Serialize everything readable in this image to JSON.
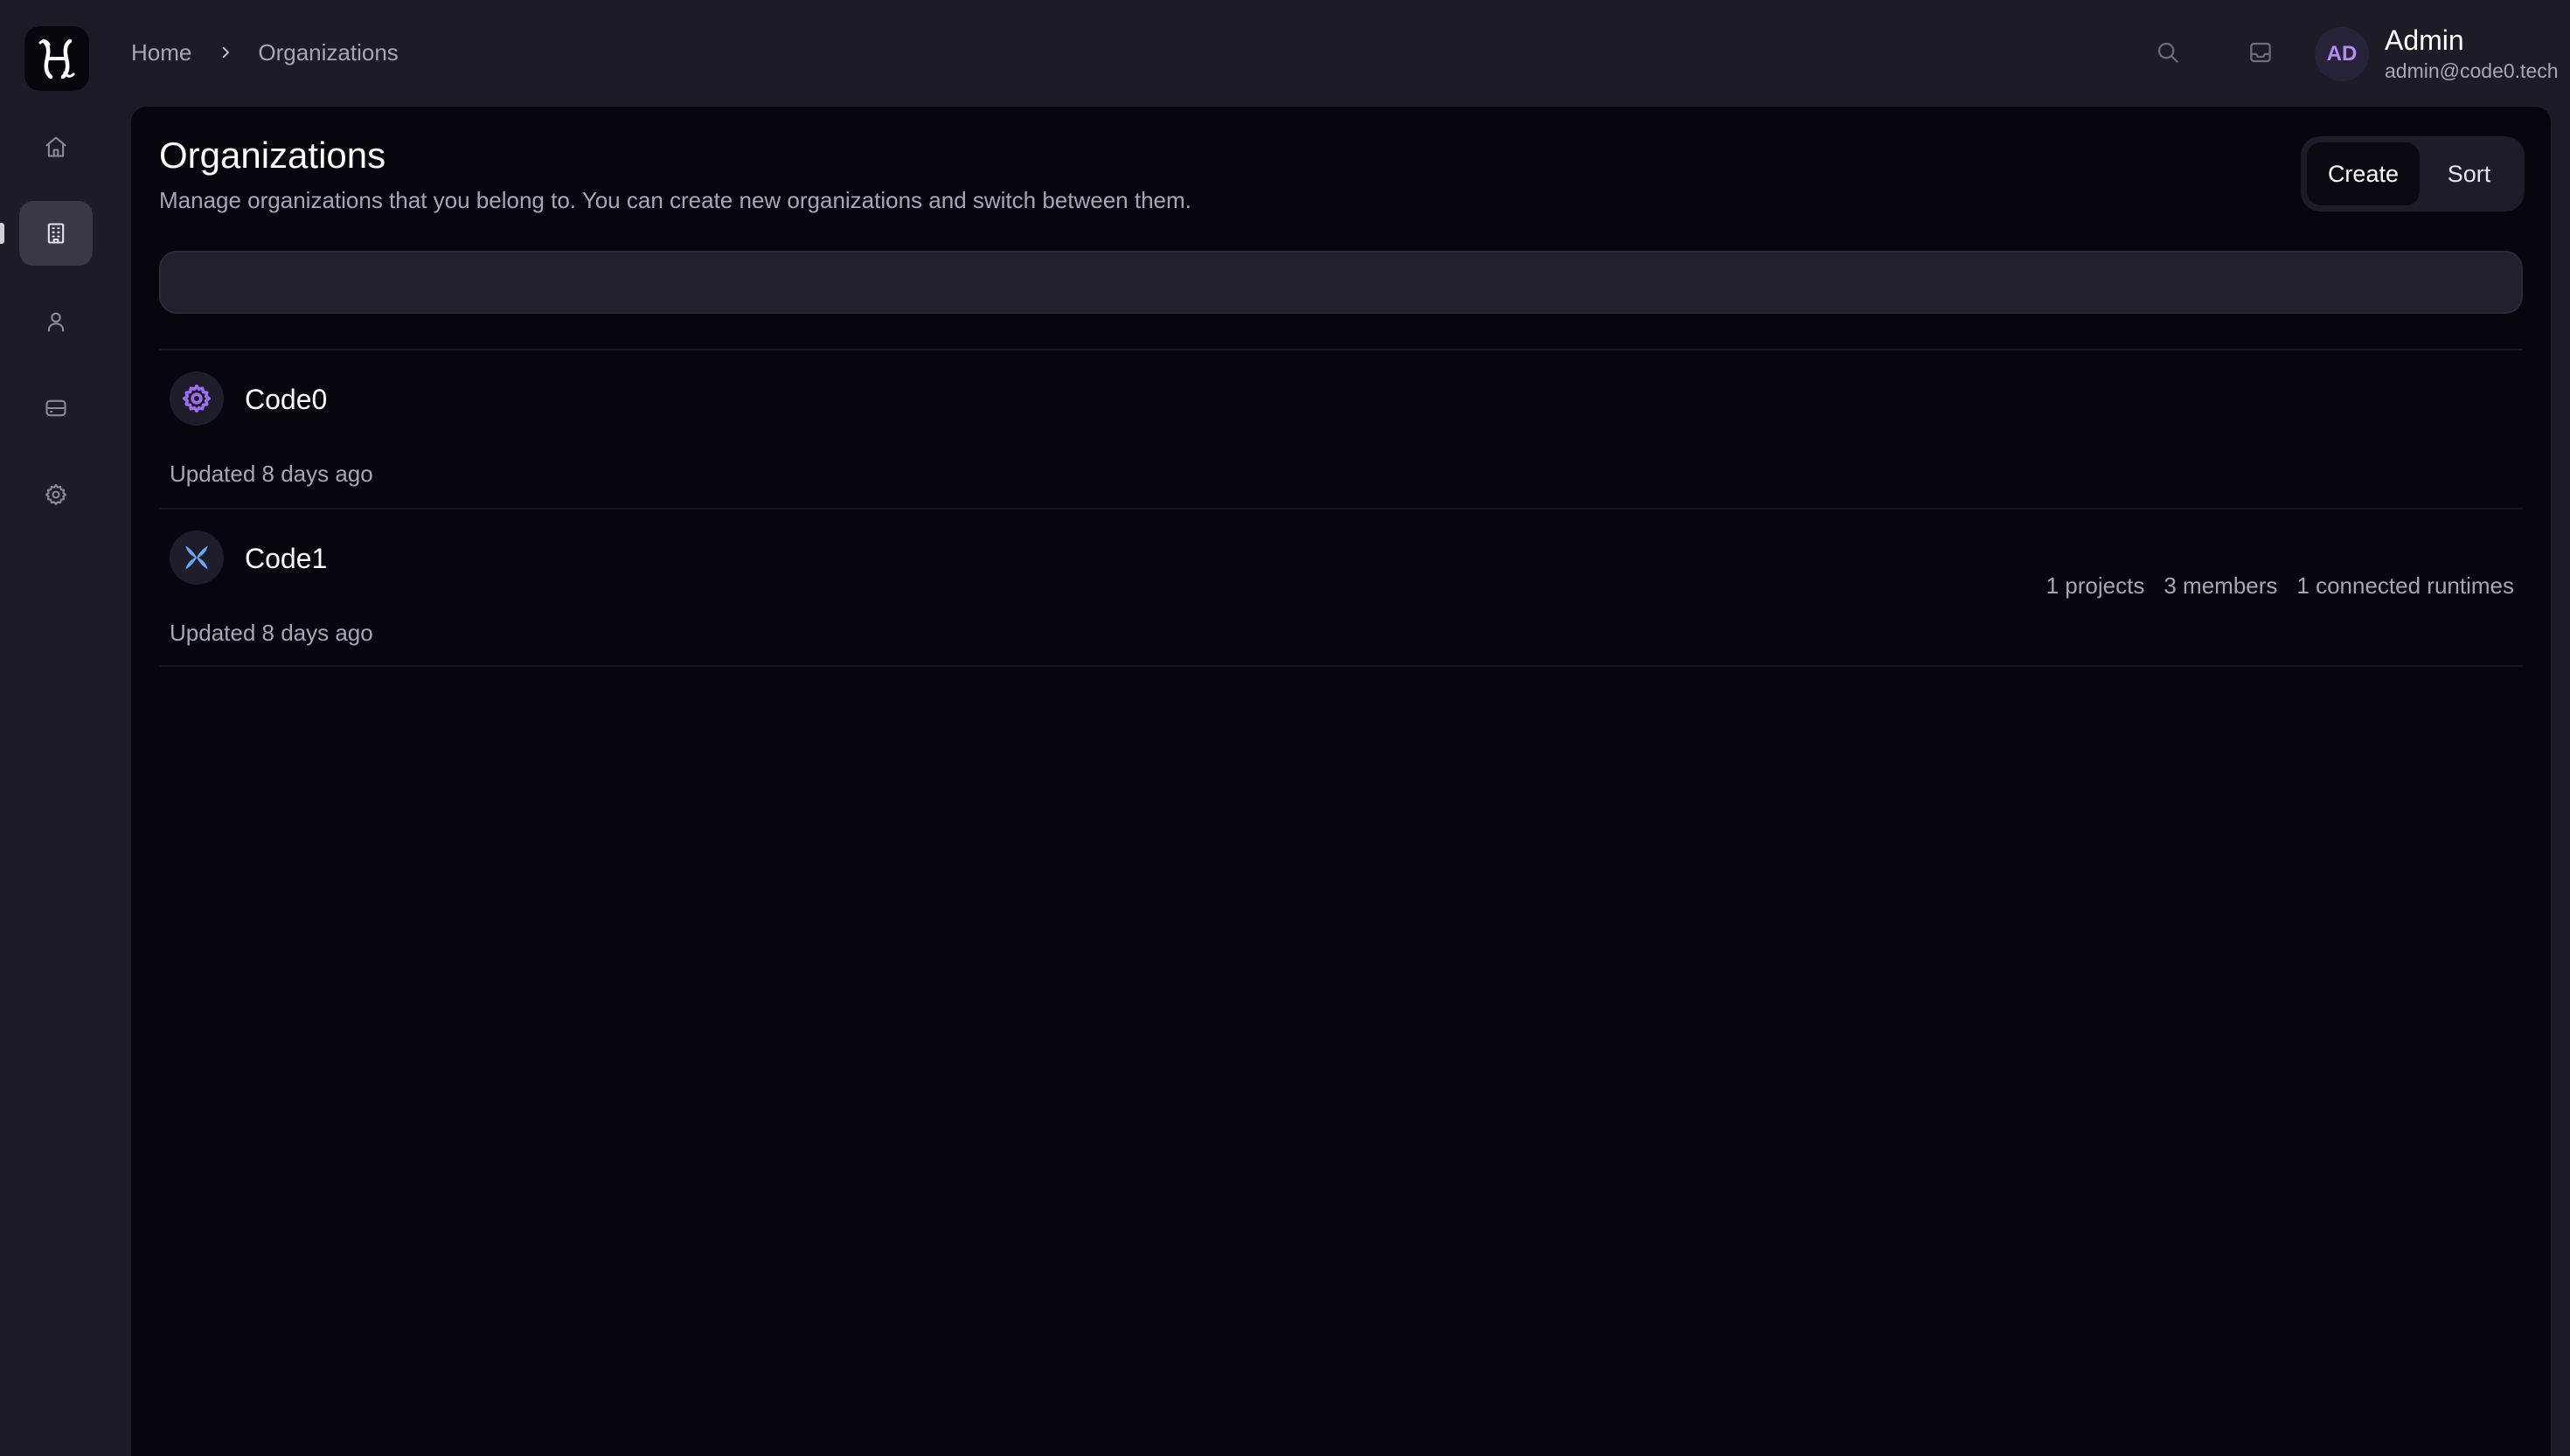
{
  "breadcrumb": {
    "home": "Home",
    "current": "Organizations"
  },
  "user": {
    "initials": "AD",
    "name": "Admin",
    "email": "admin@code0.tech"
  },
  "sidebar": {
    "items": [
      {
        "icon": "home-icon",
        "active": false
      },
      {
        "icon": "building-icon",
        "active": true
      },
      {
        "icon": "user-icon",
        "active": false
      },
      {
        "icon": "server-icon",
        "active": false
      },
      {
        "icon": "settings-icon",
        "active": false
      }
    ]
  },
  "page": {
    "title": "Organizations",
    "description": "Manage organizations that you belong to. You can create new organizations and switch between them.",
    "create_label": "Create",
    "sort_label": "Sort",
    "search_placeholder": ""
  },
  "organizations": [
    {
      "name": "Code0",
      "updated": "Updated 8 days ago",
      "icon": "gear-icon",
      "icon_color": "#9b6ff0",
      "stats": []
    },
    {
      "name": "Code1",
      "updated": "Updated 8 days ago",
      "icon": "x-icon",
      "icon_color": "#6aa7f5",
      "stats": [
        "1 projects",
        "3 members",
        "1 connected runtimes"
      ]
    }
  ],
  "colors": {
    "background": "#1d1b26",
    "panel": "#07060f",
    "accent_purple": "#b68cf2"
  }
}
